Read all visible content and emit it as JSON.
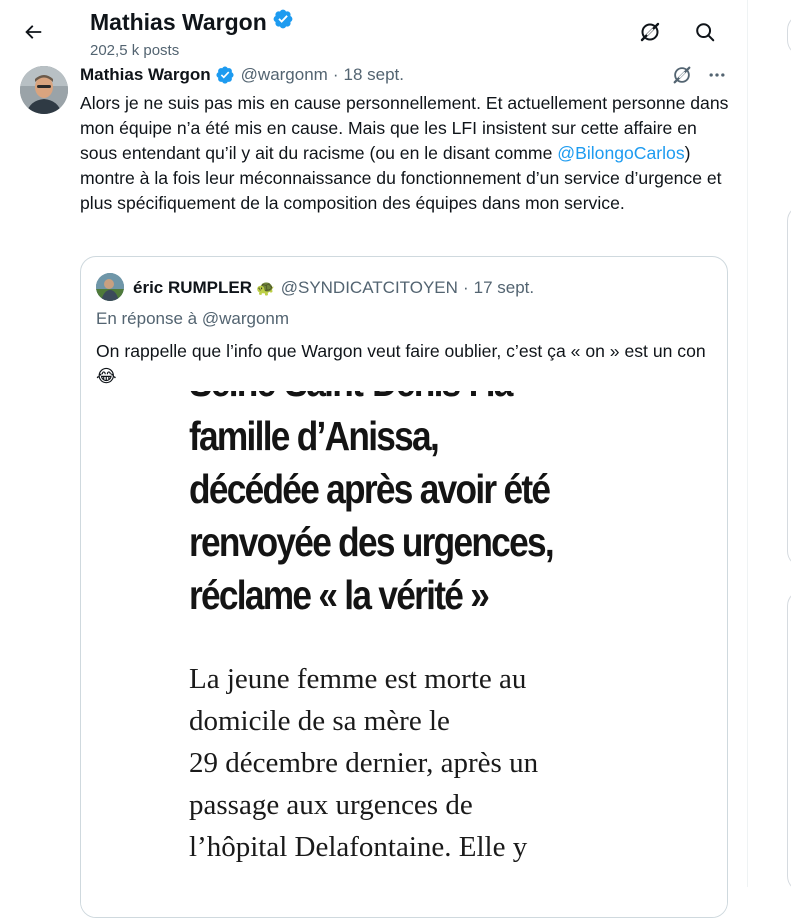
{
  "header": {
    "name": "Mathias Wargon",
    "post_count": "202,5 k posts"
  },
  "tweet": {
    "author_name": "Mathias Wargon",
    "handle": "@wargonm",
    "separator": "·",
    "date": "18 sept.",
    "text_before_mention": "Alors je ne suis pas mis en cause personnellement. Et actuellement personne dans mon équipe n’a été mis en cause. Mais que les LFI insistent sur cette affaire en sous entendant qu’il y ait du racisme (ou en le disant comme ",
    "mention": "@BilongoCarlos",
    "text_after_mention": ") montre à la fois leur méconnaissance du fonctionnement d’un service d’urgence et plus spécifiquement de la composition des équipes dans mon service."
  },
  "quote": {
    "author_name": "éric RUMPLER",
    "author_emoji": "🐢",
    "handle": "@SYNDICATCITOYEN",
    "separator": "·",
    "date": "17 sept.",
    "reply_to": "En réponse à @wargonm",
    "text": "On rappelle que l’info que Wargon veut faire oublier, c’est ça « on » est un con 😂",
    "image": {
      "headline_lines": [
        "Seine-Saint-Denis : la",
        "famille d’Anissa,",
        "décédée après avoir été",
        "renvoyée des urgences,",
        "réclame « la vérité »"
      ],
      "article_lines": [
        "La jeune femme est morte au",
        "domicile de sa mère le",
        "29 décembre dernier, après un",
        "passage aux urgences de",
        "l’hôpital Delafontaine. Elle y"
      ]
    }
  },
  "colors": {
    "accent": "#1d9bf0",
    "verified": "#1d9bf0",
    "secondary_text": "#536471"
  },
  "icons": [
    "back-arrow-icon",
    "verified-badge-icon",
    "grok-icon",
    "search-icon",
    "more-icon"
  ]
}
